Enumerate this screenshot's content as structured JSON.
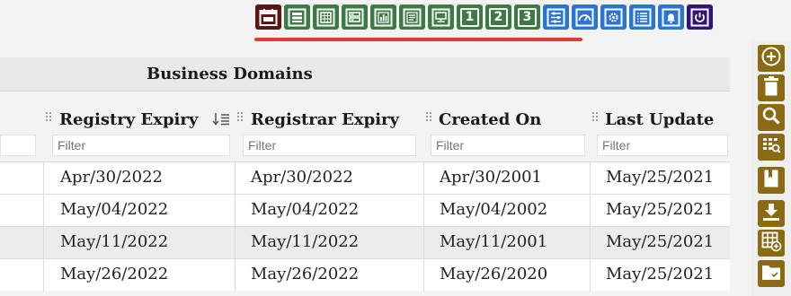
{
  "toolbar": {
    "buttons": [
      {
        "icon": "calendar-icon",
        "color": "#5a1717"
      },
      {
        "icon": "list-view-icon",
        "color": "#3d7a46"
      },
      {
        "icon": "document-grid-icon",
        "color": "#3d7a46"
      },
      {
        "icon": "split-view-icon",
        "color": "#3d7a46"
      },
      {
        "icon": "bar-chart-icon",
        "color": "#3d7a46"
      },
      {
        "icon": "detail-view-icon",
        "color": "#3d7a46"
      },
      {
        "icon": "monitor-icon",
        "color": "#3d7a46"
      },
      {
        "icon": "layout-1-icon",
        "label": "1",
        "color": "#3d7a46"
      },
      {
        "icon": "layout-2-icon",
        "label": "2",
        "color": "#3d7a46"
      },
      {
        "icon": "layout-3-icon",
        "label": "3",
        "color": "#3d7a46"
      },
      {
        "icon": "columns-settings-icon",
        "color": "#2b74cf"
      },
      {
        "icon": "dashboard-gauge-icon",
        "color": "#2b74cf"
      },
      {
        "icon": "gear-icon",
        "color": "#2b74cf"
      },
      {
        "icon": "list-icon",
        "color": "#2b74cf"
      },
      {
        "icon": "bell-icon",
        "color": "#2b74cf"
      },
      {
        "icon": "power-icon",
        "color": "#32147a"
      }
    ],
    "active_underline_color": "#e53935"
  },
  "grid": {
    "group_header": "Business Domains",
    "columns": [
      {
        "label": "",
        "filter_placeholder": ""
      },
      {
        "label": "Registry Expiry",
        "filter_placeholder": "Filter",
        "sorted": "desc"
      },
      {
        "label": "Registrar Expiry",
        "filter_placeholder": "Filter"
      },
      {
        "label": "Created On",
        "filter_placeholder": "Filter"
      },
      {
        "label": "Last Update",
        "filter_placeholder": "Filter"
      }
    ],
    "rows": [
      {
        "registry_expiry": "Apr/30/2022",
        "registrar_expiry": "Apr/30/2022",
        "created_on": "Apr/30/2001",
        "last_update": "May/25/2021"
      },
      {
        "registry_expiry": "May/04/2022",
        "registrar_expiry": "May/04/2022",
        "created_on": "May/04/2002",
        "last_update": "May/25/2021"
      },
      {
        "registry_expiry": "May/11/2022",
        "registrar_expiry": "May/11/2022",
        "created_on": "May/11/2001",
        "last_update": "May/25/2021"
      },
      {
        "registry_expiry": "May/26/2022",
        "registrar_expiry": "May/26/2022",
        "created_on": "May/26/2020",
        "last_update": "May/25/2021"
      }
    ]
  },
  "sidebar": {
    "color": "#8a6a12",
    "buttons": [
      {
        "icon": "add-circle-icon"
      },
      {
        "icon": "trash-icon"
      },
      {
        "icon": "search-icon"
      },
      {
        "icon": "grid-search-icon"
      },
      {
        "icon": "bookmark-icon"
      },
      {
        "icon": "download-icon"
      },
      {
        "icon": "add-grid-icon"
      },
      {
        "icon": "folder-check-icon"
      }
    ]
  }
}
